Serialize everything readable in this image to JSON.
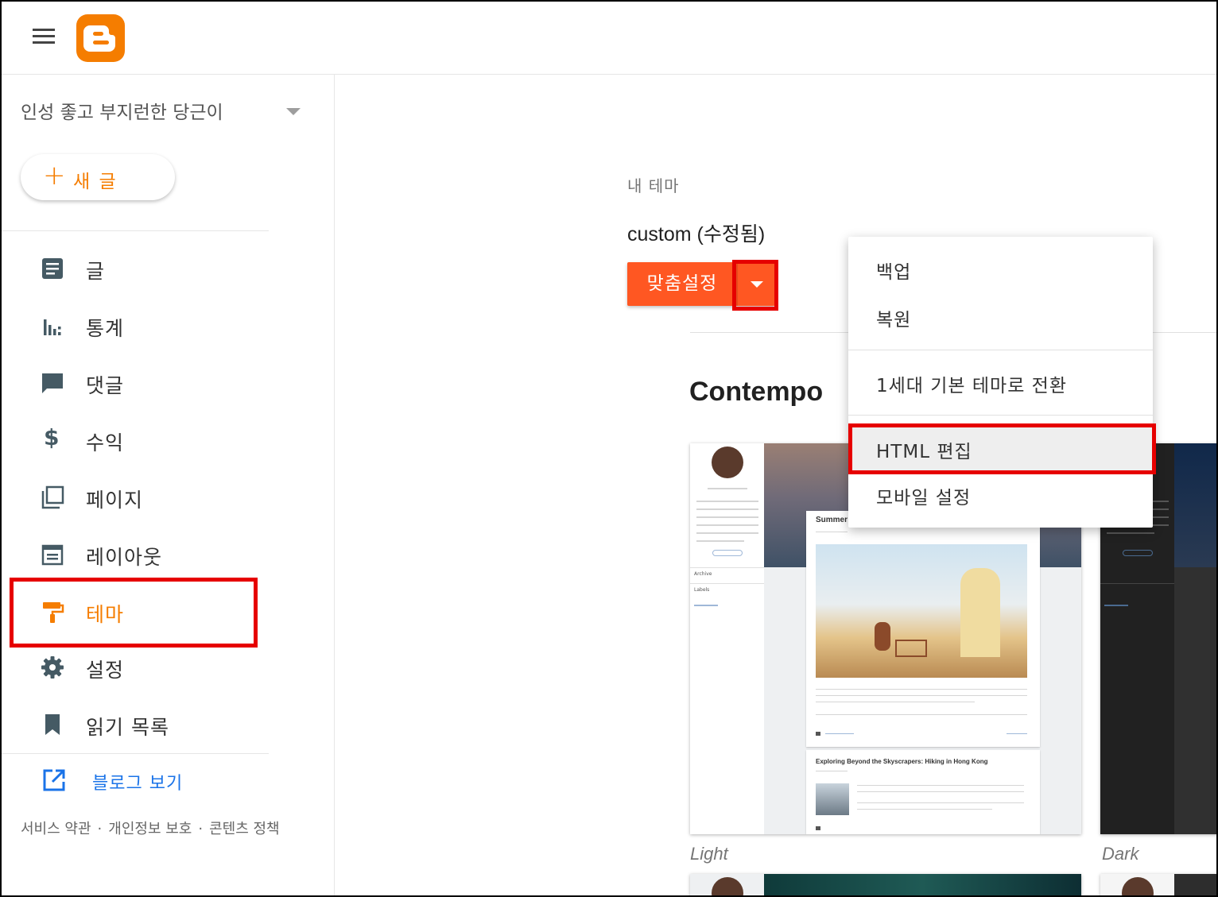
{
  "header": {
    "menu_icon": "hamburger-icon",
    "logo_icon": "blogger-logo"
  },
  "sidebar": {
    "blog_name": "인성 좋고 부지런한 당근이",
    "new_post_label": "새 글",
    "items": [
      {
        "label": "글",
        "icon": "posts-icon"
      },
      {
        "label": "통계",
        "icon": "stats-icon"
      },
      {
        "label": "댓글",
        "icon": "comments-icon"
      },
      {
        "label": "수익",
        "icon": "dollar-icon"
      },
      {
        "label": "페이지",
        "icon": "pages-icon"
      },
      {
        "label": "레이아웃",
        "icon": "layout-icon"
      },
      {
        "label": "테마",
        "icon": "theme-roller-icon",
        "active": true
      },
      {
        "label": "설정",
        "icon": "gear-icon"
      },
      {
        "label": "읽기 목록",
        "icon": "bookmark-icon"
      }
    ],
    "view_blog_label": "블로그 보기",
    "footer": {
      "terms": "서비스 약관",
      "privacy": "개인정보 보호",
      "content_policy": "콘텐츠 정책",
      "separator": "·"
    }
  },
  "main": {
    "my_theme_label": "내 테마",
    "theme_name": "custom (수정됨)",
    "customize_label": "맞춤설정",
    "gallery_title": "Contempo",
    "variants": [
      "Light",
      "Dark"
    ],
    "preview": {
      "post1_title": "Summer",
      "post2_title": "Exploring Beyond the Skyscrapers: Hiking in Hong Kong",
      "archive": "Archive",
      "labels": "Labels"
    }
  },
  "menu": {
    "items": [
      "백업",
      "복원",
      "1세대 기본 테마로 전환",
      "HTML 편집",
      "모바일 설정"
    ],
    "highlighted": "HTML 편집"
  },
  "colors": {
    "accent": "#f57d00",
    "customize_button": "#ff5722",
    "annotation": "#e60000",
    "link": "#1a73e8"
  }
}
